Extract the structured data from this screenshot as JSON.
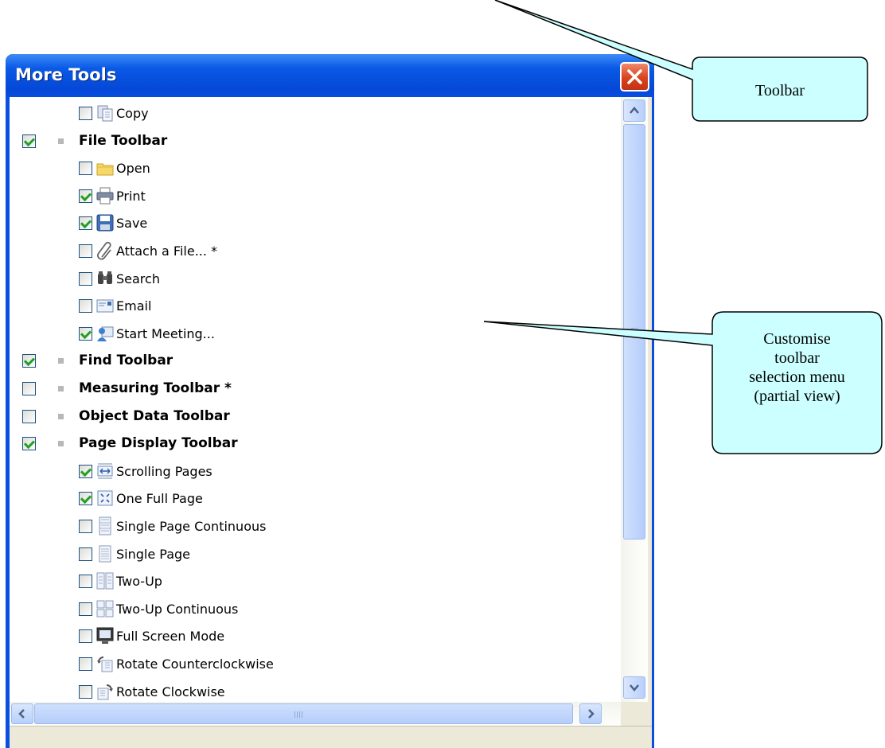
{
  "window": {
    "title": "More Tools",
    "close_icon": "close-icon"
  },
  "callouts": {
    "toolbar": "Toolbar",
    "customise_lines": [
      "Customise",
      "toolbar",
      "selection menu",
      "(partial view)"
    ]
  },
  "list": [
    {
      "kind": "item",
      "label": "Copy",
      "checked": false,
      "icon": "copy-icon"
    },
    {
      "kind": "group",
      "label": "File Toolbar",
      "checked": true
    },
    {
      "kind": "item",
      "label": "Open",
      "checked": false,
      "icon": "folder-icon"
    },
    {
      "kind": "item",
      "label": "Print",
      "checked": true,
      "icon": "printer-icon"
    },
    {
      "kind": "item",
      "label": "Save",
      "checked": true,
      "icon": "floppy-disk-icon"
    },
    {
      "kind": "item",
      "label": "Attach a File... *",
      "checked": false,
      "icon": "paperclip-icon"
    },
    {
      "kind": "item",
      "label": "Search",
      "checked": false,
      "icon": "binoculars-icon"
    },
    {
      "kind": "item",
      "label": "Email",
      "checked": false,
      "icon": "envelope-icon"
    },
    {
      "kind": "item",
      "label": "Start Meeting...",
      "checked": true,
      "icon": "meeting-icon"
    },
    {
      "kind": "group",
      "label": "Find Toolbar",
      "checked": true
    },
    {
      "kind": "group",
      "label": "Measuring Toolbar *",
      "checked": false
    },
    {
      "kind": "group",
      "label": "Object Data Toolbar",
      "checked": false
    },
    {
      "kind": "group",
      "label": "Page Display Toolbar",
      "checked": true
    },
    {
      "kind": "item",
      "label": "Scrolling Pages",
      "checked": true,
      "icon": "scrolling-pages-icon"
    },
    {
      "kind": "item",
      "label": "One Full Page",
      "checked": true,
      "icon": "fit-page-icon"
    },
    {
      "kind": "item",
      "label": "Single Page Continuous",
      "checked": false,
      "icon": "single-page-continuous-icon"
    },
    {
      "kind": "item",
      "label": "Single Page",
      "checked": false,
      "icon": "single-page-icon"
    },
    {
      "kind": "item",
      "label": "Two-Up",
      "checked": false,
      "icon": "two-up-icon"
    },
    {
      "kind": "item",
      "label": "Two-Up Continuous",
      "checked": false,
      "icon": "two-up-continuous-icon"
    },
    {
      "kind": "item",
      "label": "Full Screen Mode",
      "checked": false,
      "icon": "monitor-icon"
    },
    {
      "kind": "item",
      "label": "Rotate Counterclockwise",
      "checked": false,
      "icon": "rotate-counterclockwise-icon"
    },
    {
      "kind": "item",
      "label": "Rotate Clockwise",
      "checked": false,
      "icon": "rotate-clockwise-icon"
    }
  ],
  "scrollbars": {
    "up_icon": "chevron-up-icon",
    "down_icon": "chevron-down-icon",
    "left_icon": "chevron-left-icon",
    "right_icon": "chevron-right-icon"
  },
  "colors": {
    "titlebar": "#0a4fe0",
    "callout_fill": "#ccffff",
    "check": "#21a121"
  }
}
